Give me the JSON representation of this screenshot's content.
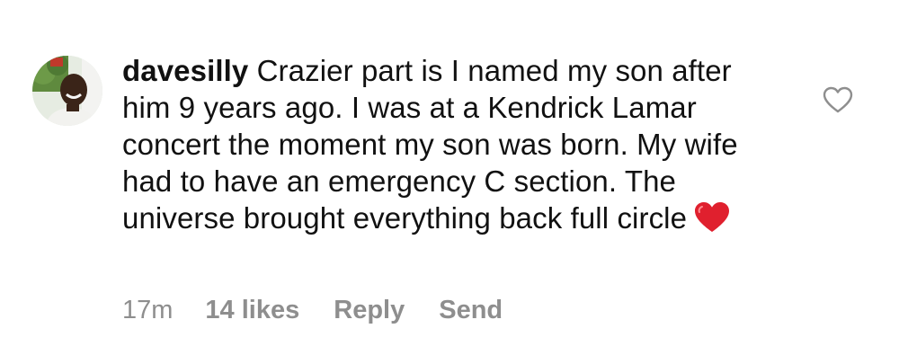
{
  "comment": {
    "username": "davesilly",
    "text": "Crazier part is I named my son after him 9 years ago. I was at a Kendrick Lamar concert the moment my son was born. My wife had to have an emergency C section. The universe brought everything back full circle",
    "emoji": "red-heart",
    "time": "17m",
    "likes": "14 likes",
    "reply_label": "Reply",
    "send_label": "Send",
    "like_icon": "heart-outline-icon"
  }
}
